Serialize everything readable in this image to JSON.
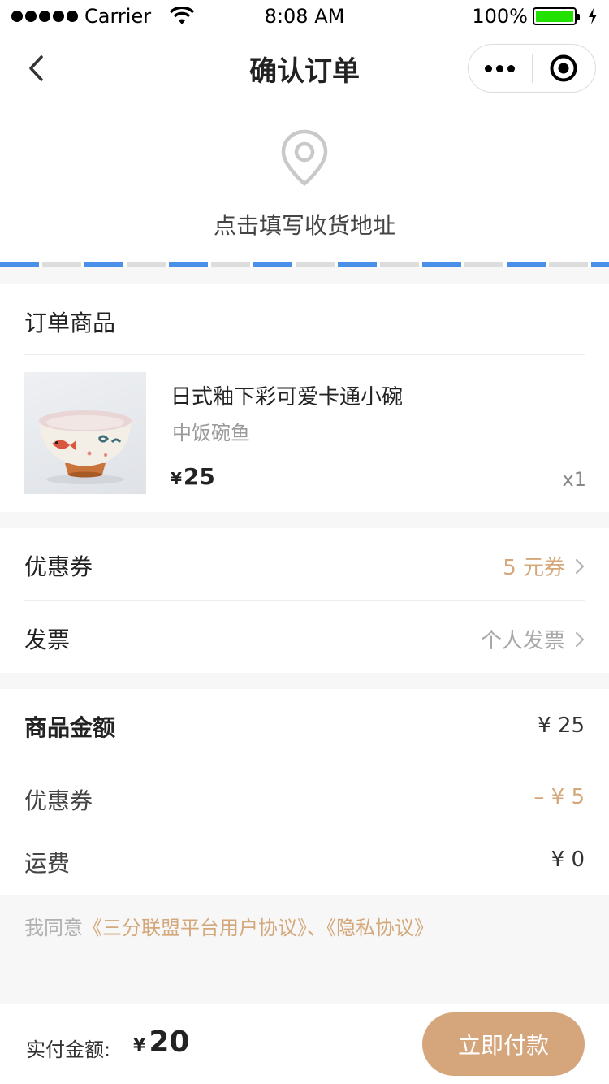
{
  "status_bar": {
    "carrier": "Carrier",
    "time": "8:08 AM",
    "battery": "100%"
  },
  "nav": {
    "title": "确认订单",
    "back_icon": "chevron-left-icon",
    "more_icon": "more-dots-icon",
    "close_icon": "target-icon"
  },
  "address": {
    "prompt": "点击填写收货地址",
    "icon": "location-pin-icon"
  },
  "goods": {
    "section_title": "订单商品",
    "items": [
      {
        "name": "日式釉下彩可爱卡通小碗",
        "spec": "中饭碗鱼",
        "currency": "¥",
        "price": "25",
        "quantity": "x1"
      }
    ]
  },
  "options": {
    "coupon_label": "优惠券",
    "coupon_value": "5 元券",
    "invoice_label": "发票",
    "invoice_value": "个人发票"
  },
  "amounts": {
    "goods_total_label": "商品金额",
    "goods_total_value": "¥ 25",
    "coupon_label": "优惠券",
    "coupon_value": "– ¥ 5",
    "shipping_label": "运费",
    "shipping_value": "¥ 0"
  },
  "agreement": {
    "prefix": "我同意",
    "links": "《三分联盟平台用户协议》、《隐私协议》"
  },
  "bottom_bar": {
    "pay_label": "实付金额:",
    "currency": "¥",
    "pay_amount": "20",
    "pay_button": "立即付款"
  },
  "colors": {
    "accent": "#d5a57b",
    "accent_text": "#d4a87a",
    "stripe_blue": "#4a90e8",
    "background_gray": "#f7f7f7",
    "battery_green": "#22e000"
  }
}
